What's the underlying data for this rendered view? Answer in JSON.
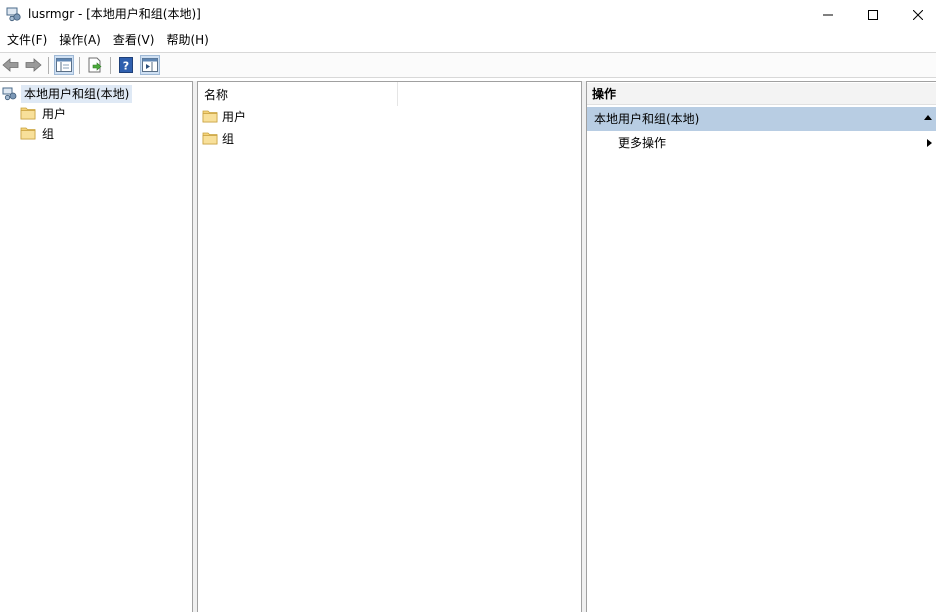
{
  "window": {
    "title": "lusrmgr - [本地用户和组(本地)]",
    "accent": "#b8cde3"
  },
  "menu": {
    "items": [
      "文件(F)",
      "操作(A)",
      "查看(V)",
      "帮助(H)"
    ]
  },
  "toolbar": {
    "icons": [
      "back-arrow-icon",
      "forward-arrow-icon",
      "show-hide-console-tree-icon",
      "export-list-icon",
      "help-icon",
      "show-hide-action-pane-icon"
    ]
  },
  "tree": {
    "root_label": "本地用户和组(本地)",
    "children": [
      "用户",
      "组"
    ]
  },
  "list": {
    "column_header": "名称",
    "items": [
      "用户",
      "组"
    ]
  },
  "actions": {
    "header": "操作",
    "group_label": "本地用户和组(本地)",
    "more_label": "更多操作"
  }
}
